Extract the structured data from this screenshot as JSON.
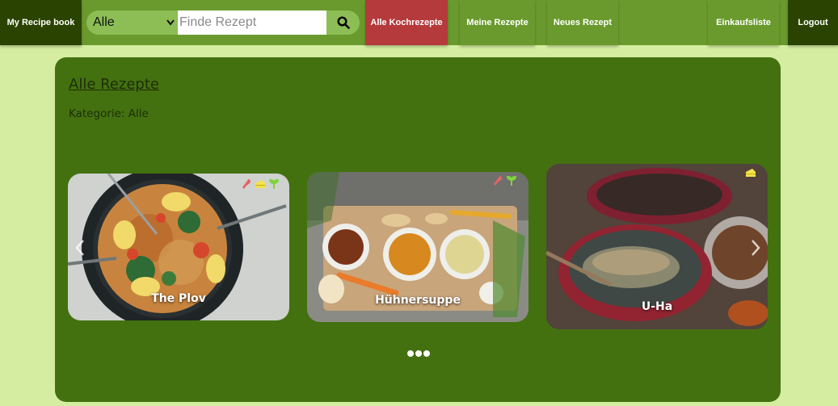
{
  "nav": {
    "brand": "My Recipe book",
    "category_select": "Alle",
    "search_placeholder": "Finde Rezept",
    "all_recipes": "Alle Kochrezepte",
    "my_recipes": "Meine Rezepte",
    "new_recipe": "Neues Rezept",
    "shopping_list": "Einkaufsliste",
    "logout": "Logout"
  },
  "main": {
    "title": "Alle Rezepte",
    "category": "Kategorie: Alle"
  },
  "recipes": [
    {
      "title": "The Plov",
      "icons": [
        "meat-icon",
        "cheese-icon",
        "vegetable-icon"
      ]
    },
    {
      "title": "Hühnersuppe",
      "icons": [
        "meat-icon",
        "vegetable-icon"
      ]
    },
    {
      "title": "U-Ha",
      "icons": [
        "cheese-icon"
      ]
    }
  ],
  "carousel": {
    "slide_count": 3
  },
  "colors": {
    "page_bg": "#d4eda0",
    "navbar": "#6a9a2d",
    "brand": "#2a4300",
    "active_nav": "#b53a3c",
    "panel": "#437110"
  }
}
